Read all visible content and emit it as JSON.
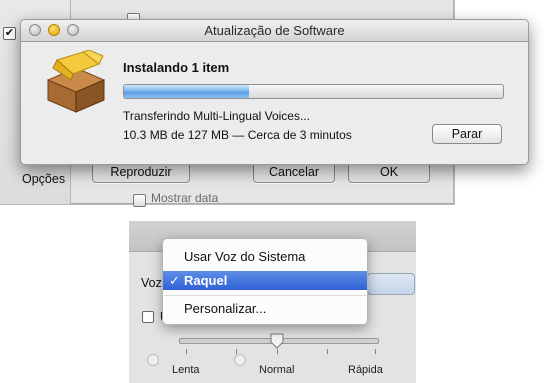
{
  "background_window": {
    "left_checkbox_mark": "✔",
    "options_label": "Opções",
    "play_button": "Reproduzir",
    "cancel_button": "Cancelar",
    "ok_button": "OK",
    "show_date_label": "Mostrar data"
  },
  "update_dialog": {
    "title": "Atualização de Software",
    "heading": "Instalando 1 item",
    "progress_fraction": 0.33,
    "status": "Transferindo Multi-Lingual Voices...",
    "detail": "10.3 MB de 127 MB — Cerca de 3 minutos",
    "stop_button": "Parar",
    "icon": "package-icon"
  },
  "voice_panel": {
    "voice_label": "Voz",
    "checkbox_label": "U",
    "menu": {
      "items": [
        {
          "label": "Usar Voz do Sistema",
          "selected": false
        },
        {
          "label": "Raquel",
          "selected": true
        },
        {
          "label": "Personalizar...",
          "selected": false
        }
      ],
      "checkmark": "✓"
    },
    "rate_slider": {
      "labels": [
        "Lenta",
        "Normal",
        "Rápida"
      ],
      "value": "Normal"
    }
  },
  "colors": {
    "selection_blue": "#2f61d6",
    "progress_blue": "#5a9de3"
  }
}
